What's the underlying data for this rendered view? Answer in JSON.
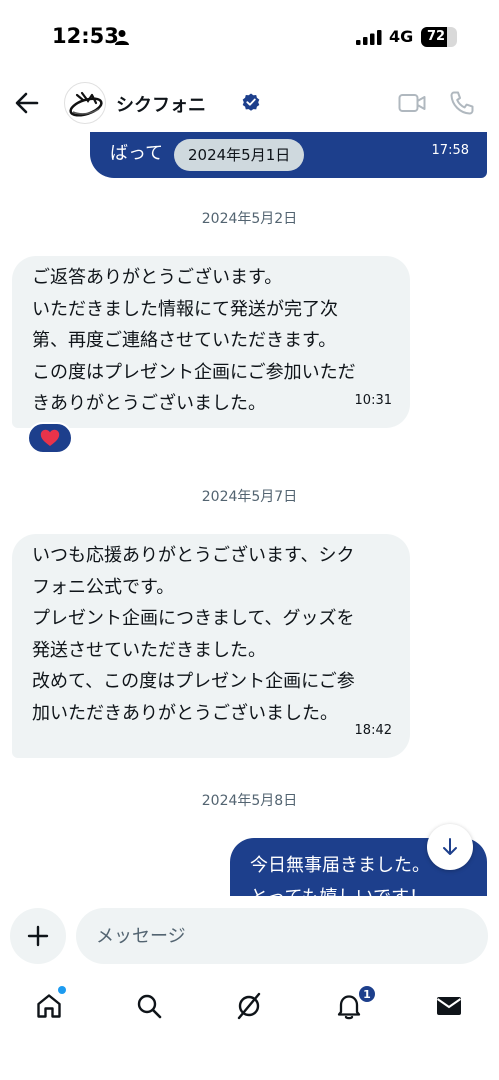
{
  "status_bar": {
    "time": "12:53",
    "network": "4G",
    "battery_level": "72",
    "battery_fraction": 0.72
  },
  "header": {
    "contact_name": "シクフォニ",
    "verified": true,
    "icons": {
      "back": "arrow-left-icon",
      "video": "video-camera-icon",
      "phone": "phone-icon",
      "verified": "verified-badge-icon"
    }
  },
  "chat": {
    "top_message": {
      "line": "ばって",
      "time": "17:58"
    },
    "floating_date": "2024年5月1日",
    "sections": [
      {
        "date": "2024年5月2日",
        "message": {
          "lines": [
            "ご返答ありがとうございます。",
            "いただきました情報にて発送が完了次",
            "第、再度ご連絡させていただきます。",
            "この度はプレゼント企画にご参加いただ",
            "きありがとうございました。"
          ],
          "time": "10:31",
          "reaction": "❤️"
        }
      },
      {
        "date": "2024年5月7日",
        "message": {
          "lines": [
            "いつも応援ありがとうございます、シク",
            "フォニ公式です。",
            "プレゼント企画につきまして、グッズを",
            "発送させていただきました。",
            "改めて、この度はプレゼント企画にご参",
            "加いただきありがとうございました。"
          ],
          "time": "18:42"
        }
      },
      {
        "date": "2024年5月8日",
        "message": {
          "lines": [
            "今日無事届きました。",
            "とっても嬉しいです！"
          ]
        }
      }
    ]
  },
  "composer": {
    "placeholder": "メッセージ"
  },
  "tabbar": {
    "tabs": [
      "home-icon",
      "search-icon",
      "grok-icon",
      "notifications-icon",
      "messages-icon"
    ],
    "notification_count": "1"
  },
  "colors": {
    "accent": "#1d3f8c",
    "bubble_in": "#eff3f4",
    "secondary_text": "#536471",
    "verified": "#1d3f8c"
  }
}
